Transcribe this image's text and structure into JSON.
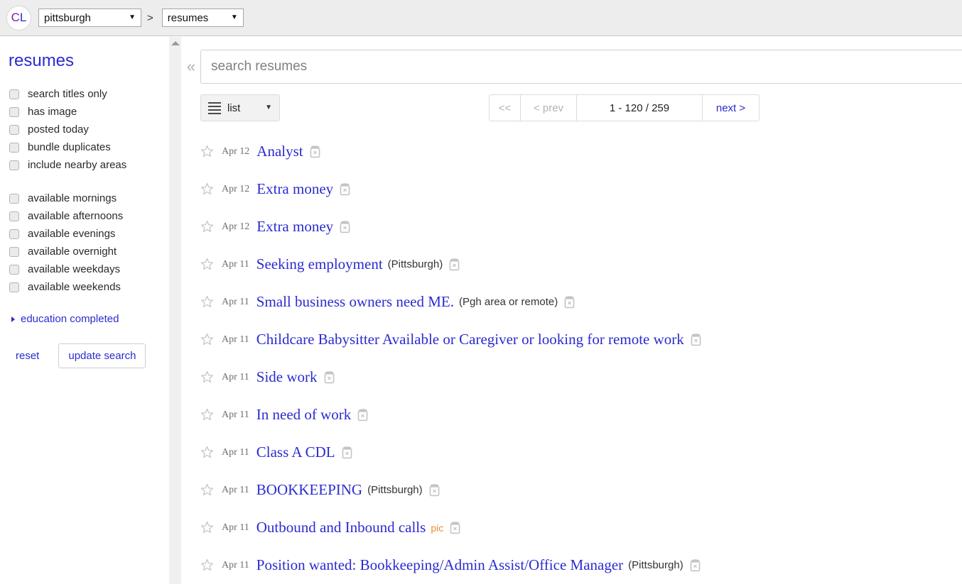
{
  "header": {
    "logo": {
      "c": "C",
      "l": "L",
      "icon": "craigslist-logo-icon"
    },
    "area_select": {
      "value": "pittsburgh",
      "caret": "▼"
    },
    "separator": ">",
    "category_select": {
      "value": "resumes",
      "caret": "▼"
    }
  },
  "sidebar": {
    "title": "resumes",
    "filters_primary": [
      {
        "label": "search titles only",
        "checked": false
      },
      {
        "label": "has image",
        "checked": false
      },
      {
        "label": "posted today",
        "checked": false
      },
      {
        "label": "bundle duplicates",
        "checked": false
      },
      {
        "label": "include nearby areas",
        "checked": false
      }
    ],
    "filters_availability": [
      {
        "label": "available mornings",
        "checked": false
      },
      {
        "label": "available afternoons",
        "checked": false
      },
      {
        "label": "available evenings",
        "checked": false
      },
      {
        "label": "available overnight",
        "checked": false
      },
      {
        "label": "available weekdays",
        "checked": false
      },
      {
        "label": "available weekends",
        "checked": false
      }
    ],
    "education_expander": {
      "label": "education completed",
      "expanded": false
    },
    "reset_label": "reset",
    "update_search_label": "update search"
  },
  "main": {
    "collapse_chevron": "«",
    "search": {
      "value": "",
      "placeholder": "search resumes"
    },
    "view_select": {
      "label": "list",
      "caret": "▼",
      "icon": "hamburger-icon"
    },
    "paginator": {
      "first_label": "<<",
      "prev_label": "< prev",
      "range_label": "1 - 120 / 259",
      "next_label": "next >",
      "range_start": 1,
      "range_end": 120,
      "total": 259
    },
    "results": [
      {
        "date": "Apr 12",
        "title": "Analyst",
        "hood": "",
        "pic": ""
      },
      {
        "date": "Apr 12",
        "title": "Extra money",
        "hood": "",
        "pic": ""
      },
      {
        "date": "Apr 12",
        "title": "Extra money",
        "hood": "",
        "pic": ""
      },
      {
        "date": "Apr 11",
        "title": "Seeking employment",
        "hood": "(Pittsburgh)",
        "pic": ""
      },
      {
        "date": "Apr 11",
        "title": "Small business owners need ME.",
        "hood": "(Pgh area or remote)",
        "pic": ""
      },
      {
        "date": "Apr 11",
        "title": "Childcare Babysitter Available or Caregiver or looking for remote work",
        "hood": "",
        "pic": ""
      },
      {
        "date": "Apr 11",
        "title": "Side work",
        "hood": "",
        "pic": ""
      },
      {
        "date": "Apr 11",
        "title": "In need of work",
        "hood": "",
        "pic": ""
      },
      {
        "date": "Apr 11",
        "title": "Class A CDL",
        "hood": "",
        "pic": ""
      },
      {
        "date": "Apr 11",
        "title": "BOOKKEEPING",
        "hood": "(Pittsburgh)",
        "pic": ""
      },
      {
        "date": "Apr 11",
        "title": "Outbound and Inbound calls",
        "hood": "",
        "pic": "pic"
      },
      {
        "date": "Apr 11",
        "title": "Position wanted: Bookkeeping/Admin Assist/Office Manager",
        "hood": "(Pittsburgh)",
        "pic": ""
      }
    ]
  },
  "colors": {
    "link": "#2b2bd0",
    "header_bg": "#ededed",
    "pic_tag": "#e8912a",
    "logo_c": "#7e1ba0",
    "logo_l": "#2b2bd0"
  }
}
